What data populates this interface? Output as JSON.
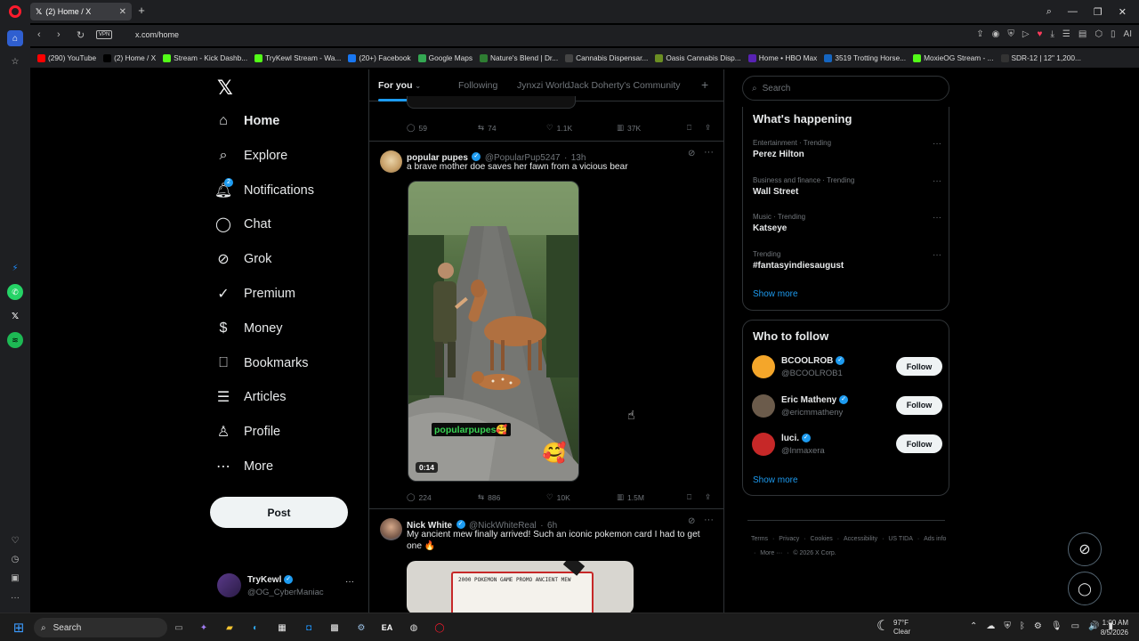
{
  "browser": {
    "tab_title": "(2) Home / X",
    "url": "x.com/home",
    "vpn_label": "VPN",
    "ai_label": "AI",
    "bookmarks": [
      {
        "label": "(290) YouTube",
        "color": "#ff0000"
      },
      {
        "label": "(2) Home / X",
        "color": "#000000"
      },
      {
        "label": "Stream - Kick Dashb...",
        "color": "#53fc18"
      },
      {
        "label": "TryKewl Stream - Wa...",
        "color": "#53fc18"
      },
      {
        "label": "(20+) Facebook",
        "color": "#1877f2"
      },
      {
        "label": "Google Maps",
        "color": "#34a853"
      },
      {
        "label": "Nature's Blend | Dr...",
        "color": "#2e7d32"
      },
      {
        "label": "Cannabis Dispensar...",
        "color": "#444444"
      },
      {
        "label": "Oasis Cannabis Disp...",
        "color": "#6b8e23"
      },
      {
        "label": "Home • HBO Max",
        "color": "#5822b4"
      },
      {
        "label": "3519 Trotting Horse...",
        "color": "#1565c0"
      },
      {
        "label": "MoxieOG Stream - ...",
        "color": "#53fc18"
      },
      {
        "label": "SDR-12 | 12\" 1,200...",
        "color": "#333333"
      }
    ]
  },
  "nav": {
    "items": [
      {
        "label": "Home",
        "icon": "home-icon"
      },
      {
        "label": "Explore",
        "icon": "search-icon"
      },
      {
        "label": "Notifications",
        "icon": "bell-icon",
        "badge": "2"
      },
      {
        "label": "Chat",
        "icon": "chat-icon"
      },
      {
        "label": "Grok",
        "icon": "grok-icon"
      },
      {
        "label": "Premium",
        "icon": "premium-icon"
      },
      {
        "label": "Money",
        "icon": "money-icon"
      },
      {
        "label": "Bookmarks",
        "icon": "bookmark-icon"
      },
      {
        "label": "Articles",
        "icon": "articles-icon"
      },
      {
        "label": "Profile",
        "icon": "profile-icon"
      },
      {
        "label": "More",
        "icon": "more-icon"
      }
    ],
    "post_button": "Post",
    "account": {
      "name": "TryKewl",
      "handle": "@OG_CyberManiac"
    }
  },
  "feed": {
    "tabs": [
      "For you",
      "Following",
      "Jynxzi World",
      "Jack Doherty's Community"
    ],
    "active_tab": "For you",
    "prev_post_stats": {
      "replies": "59",
      "reposts": "74",
      "likes": "1.1K",
      "views": "37K"
    },
    "posts": [
      {
        "name": "popular pupes",
        "handle": "@PopularPup5247",
        "time": "13h",
        "text": "a brave mother doe saves her fawn from a vicious bear",
        "video_caption": "popularpupes🥰",
        "video_duration": "0:14",
        "replies": "224",
        "reposts": "886",
        "likes": "10K",
        "views": "1.5M"
      },
      {
        "name": "Nick White",
        "handle": "@NickWhiteReal",
        "time": "6h",
        "text": "My ancient mew finally arrived! Such an iconic pokemon card I had to get one 🔥",
        "card_text": "2000 POKEMON GAME PROMO ANCIENT MEW"
      }
    ]
  },
  "right": {
    "search_placeholder": "Search",
    "whats_happening": {
      "title": "What's happening",
      "trends": [
        {
          "category": "Entertainment · Trending",
          "title": "Perez Hilton"
        },
        {
          "category": "Business and finance · Trending",
          "title": "Wall Street"
        },
        {
          "category": "Music · Trending",
          "title": "Katseye"
        },
        {
          "category": "Trending",
          "title": "#fantasyindiesaugust"
        }
      ],
      "show_more": "Show more"
    },
    "who_to_follow": {
      "title": "Who to follow",
      "accounts": [
        {
          "name": "BCOOLROB",
          "handle": "@BCOOLROB1",
          "color": "#f4a62a"
        },
        {
          "name": "Eric Matheny",
          "handle": "@ericmmatheny",
          "color": "#6b5b4b"
        },
        {
          "name": "luci.",
          "handle": "@lnmaxera",
          "color": "#c62828"
        }
      ],
      "follow_label": "Follow",
      "show_more": "Show more"
    },
    "footer": {
      "links": [
        "Terms",
        "Privacy",
        "Cookies",
        "Accessibility",
        "US TIDA",
        "Ads info",
        "More ···",
        "© 2026 X Corp."
      ]
    }
  },
  "taskbar": {
    "search_label": "Search",
    "weather_temp": "97°F",
    "weather_desc": "Clear",
    "time": "1:00 AM",
    "date": "8/5/2026"
  }
}
